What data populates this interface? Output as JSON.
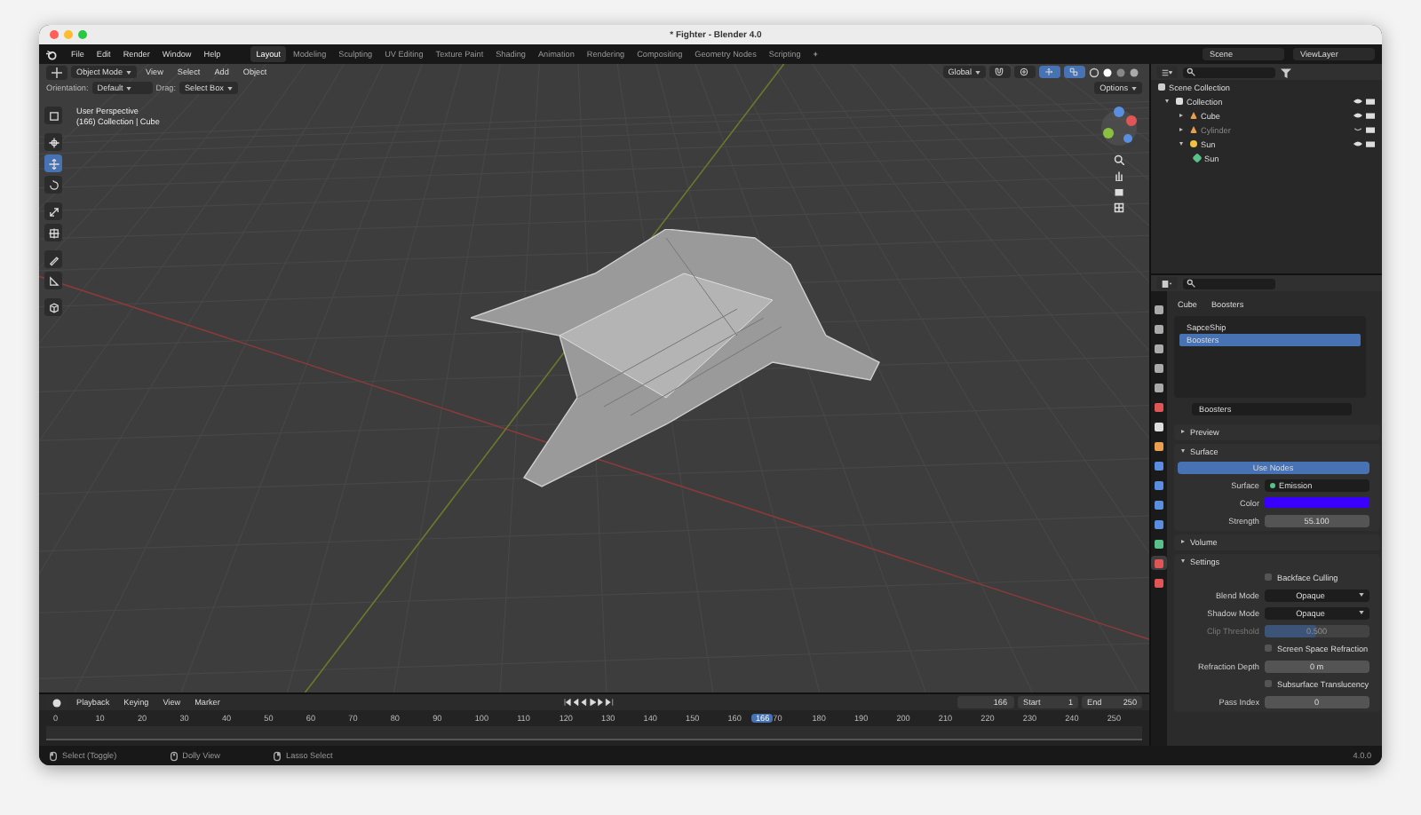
{
  "window": {
    "title": "* Fighter - Blender 4.0"
  },
  "menu": [
    "File",
    "Edit",
    "Render",
    "Window",
    "Help"
  ],
  "workspaces": [
    {
      "label": "Layout",
      "selected": true
    },
    {
      "label": "Modeling",
      "selected": false
    },
    {
      "label": "Sculpting",
      "selected": false
    },
    {
      "label": "UV Editing",
      "selected": false
    },
    {
      "label": "Texture Paint",
      "selected": false
    },
    {
      "label": "Shading",
      "selected": false
    },
    {
      "label": "Animation",
      "selected": false
    },
    {
      "label": "Rendering",
      "selected": false
    },
    {
      "label": "Compositing",
      "selected": false
    },
    {
      "label": "Geometry Nodes",
      "selected": false
    },
    {
      "label": "Scripting",
      "selected": false
    }
  ],
  "add_workspace": "+",
  "scene": {
    "scene": "Scene",
    "view_layer": "ViewLayer"
  },
  "viewport": {
    "toggles": [
      {
        "kind": "snap",
        "on": false
      },
      {
        "kind": "proportional-edit",
        "on": false
      },
      {
        "kind": "gizmo",
        "on": true
      },
      {
        "kind": "overlay",
        "on": true
      }
    ],
    "mode": "Object Mode",
    "menus": [
      "View",
      "Select",
      "Add",
      "Object"
    ],
    "transform": "Global",
    "orientation_label": "Orientation:",
    "orientation": "Default",
    "drag_label": "Drag:",
    "drag": "Select Box",
    "options": "Options",
    "overlay": [
      "User Perspective",
      "(166) Collection | Cube"
    ],
    "tools": [
      {
        "kind": "select",
        "selected": false
      },
      {
        "kind": "cursor",
        "selected": false
      },
      {
        "kind": "move",
        "selected": true
      },
      {
        "kind": "rotate",
        "selected": false
      },
      {
        "kind": "scale",
        "selected": false
      },
      {
        "kind": "transform",
        "selected": false
      },
      {
        "kind": "annotate",
        "selected": false
      },
      {
        "kind": "measure",
        "selected": false
      },
      {
        "kind": "add-cube",
        "selected": false
      }
    ]
  },
  "outliner": {
    "root": "Scene Collection",
    "items": [
      {
        "name": "Collection",
        "kind": "collection",
        "expanded": true,
        "visible": true,
        "children": [
          {
            "name": "Cube",
            "kind": "mesh",
            "expanded": false,
            "visible": true
          },
          {
            "name": "Cylinder",
            "kind": "mesh",
            "expanded": false,
            "visible": false
          },
          {
            "name": "Sun",
            "kind": "light",
            "expanded": true,
            "visible": true,
            "children": [
              {
                "name": "Sun",
                "kind": "light-data"
              }
            ]
          }
        ]
      }
    ]
  },
  "properties": {
    "tabs": [
      {
        "kind": "tool",
        "selected": false
      },
      {
        "kind": "render",
        "selected": false
      },
      {
        "kind": "output",
        "selected": false
      },
      {
        "kind": "view-layer",
        "selected": false
      },
      {
        "kind": "scene",
        "selected": false
      },
      {
        "kind": "world",
        "selected": false
      },
      {
        "kind": "collection",
        "selected": false
      },
      {
        "kind": "object",
        "selected": false
      },
      {
        "kind": "modifiers",
        "selected": false
      },
      {
        "kind": "particles",
        "selected": false
      },
      {
        "kind": "physics",
        "selected": false
      },
      {
        "kind": "constraints",
        "selected": false
      },
      {
        "kind": "data",
        "selected": false
      },
      {
        "kind": "material",
        "selected": true
      },
      {
        "kind": "texture",
        "selected": false
      }
    ],
    "breadcrumb": [
      "Cube",
      "Boosters"
    ],
    "slots": [
      {
        "name": "SapceShip",
        "selected": false
      },
      {
        "name": "Boosters",
        "selected": true
      }
    ],
    "material": "Boosters",
    "panels": [
      {
        "title": "Preview",
        "expanded": false
      },
      {
        "title": "Surface",
        "expanded": true,
        "rows": [
          {
            "kind": "button",
            "value": "Use Nodes"
          },
          {
            "kind": "link",
            "label": "Surface",
            "value": "Emission"
          },
          {
            "kind": "color",
            "label": "Color",
            "color": "#3a00ff"
          },
          {
            "kind": "number",
            "label": "Strength",
            "value": "55.100"
          }
        ]
      },
      {
        "title": "Volume",
        "expanded": false
      },
      {
        "title": "Settings",
        "expanded": true,
        "rows": [
          {
            "kind": "checkbox",
            "value": "Backface Culling",
            "checked": false
          },
          {
            "kind": "dropdown",
            "label": "Blend Mode",
            "value": "Opaque"
          },
          {
            "kind": "dropdown",
            "label": "Shadow Mode",
            "value": "Opaque"
          },
          {
            "kind": "slider",
            "label": "Clip Threshold",
            "value": "0.500",
            "level": 0.5,
            "disabled": true
          },
          {
            "kind": "checkbox",
            "value": "Screen Space Refraction",
            "checked": false
          },
          {
            "kind": "number",
            "label": "Refraction Depth",
            "value": "0 m"
          },
          {
            "kind": "checkbox",
            "value": "Subsurface Translucency",
            "checked": false
          },
          {
            "kind": "number",
            "label": "Pass Index",
            "value": "0"
          }
        ]
      }
    ]
  },
  "timeline": {
    "menus": [
      "Playback",
      "Keying",
      "View",
      "Marker"
    ],
    "current_frame": "166",
    "playhead": "166",
    "start_label": "Start",
    "start": "1",
    "end_label": "End",
    "end": "250",
    "ticks": [
      "0",
      "10",
      "20",
      "30",
      "40",
      "50",
      "60",
      "70",
      "80",
      "90",
      "100",
      "110",
      "120",
      "130",
      "140",
      "150",
      "160",
      "70",
      "180",
      "190",
      "200",
      "210",
      "220",
      "230",
      "240",
      "250"
    ]
  },
  "status_bar": {
    "hints": [
      {
        "kind": "mouse-left",
        "label": "Select (Toggle)"
      },
      {
        "kind": "mouse-middle",
        "label": "Dolly View"
      },
      {
        "kind": "mouse-right",
        "label": "Lasso Select"
      }
    ],
    "version": "4.0.0"
  }
}
